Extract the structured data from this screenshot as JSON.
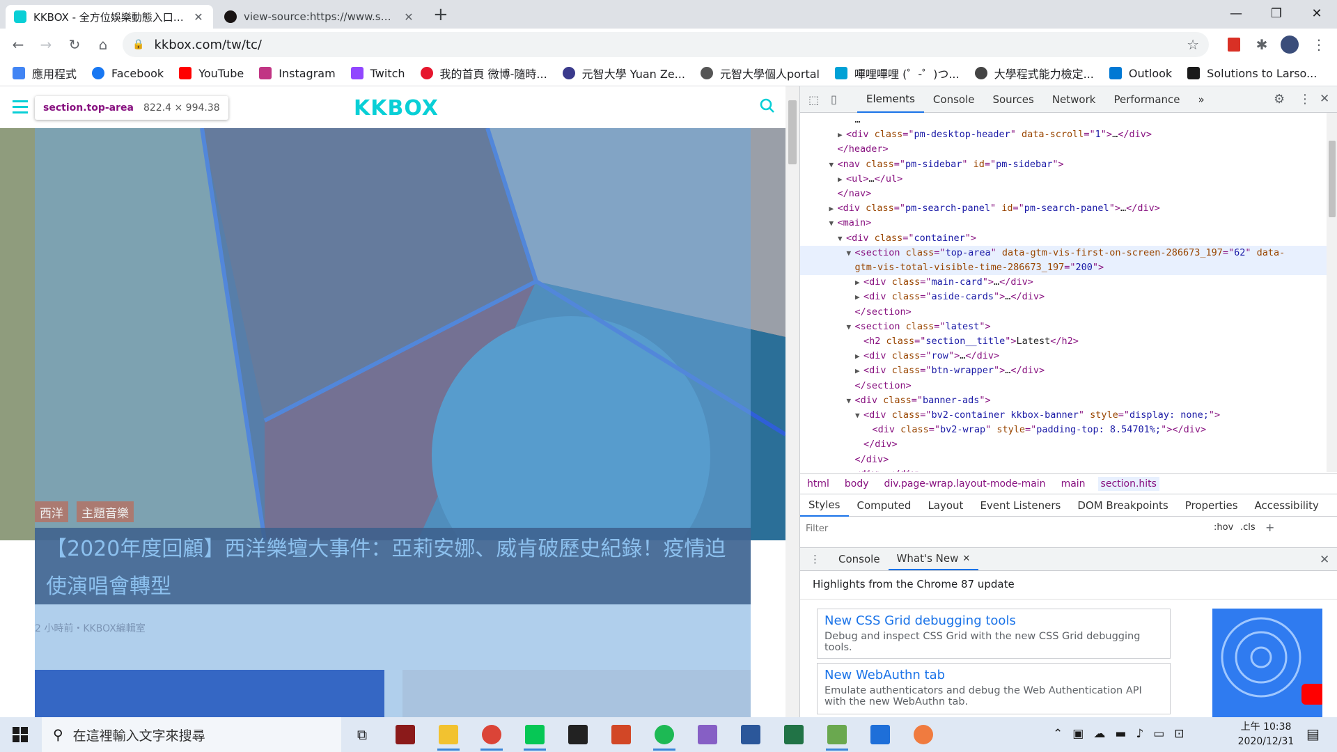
{
  "browser": {
    "tabs": [
      {
        "title": "KKBOX - 全方位娛樂動態入口網站",
        "active": true
      },
      {
        "title": "view-source:https://www.spotify",
        "active": false
      }
    ],
    "new_tab_label": "+",
    "url": "kkbox.com/tw/tc/",
    "bookmarks": [
      {
        "label": "應用程式",
        "color": "#4285f4"
      },
      {
        "label": "Facebook",
        "color": "#1877f2"
      },
      {
        "label": "YouTube",
        "color": "#ff0000"
      },
      {
        "label": "Instagram",
        "color": "#c13584"
      },
      {
        "label": "Twitch",
        "color": "#9146ff"
      },
      {
        "label": "我的首頁 微博-隨時...",
        "color": "#e6162d"
      },
      {
        "label": "元智大學 Yuan Ze...",
        "color": "#3a3a8c"
      },
      {
        "label": "元智大學個人portal",
        "color": "#555555"
      },
      {
        "label": "嗶哩嗶哩 (゜-゜)つ...",
        "color": "#00a1d6"
      },
      {
        "label": "大學程式能力檢定...",
        "color": "#444444"
      },
      {
        "label": "Outlook",
        "color": "#0078d4"
      },
      {
        "label": "Solutions to Larso...",
        "color": "#1a1a1a"
      }
    ]
  },
  "page": {
    "logo": "KKBOX",
    "tooltip_selector": "section.top-area",
    "tooltip_dims": "822.4 × 994.38",
    "chips": [
      "西洋",
      "主題音樂"
    ],
    "headline": "【2020年度回顧】西洋樂壇大事件：亞莉安娜、威肯破歷史紀錄！疫情迫使演唱會轉型",
    "meta": "2 小時前・KKBOX編輯室"
  },
  "devtools": {
    "tabs": [
      "Elements",
      "Console",
      "Sources",
      "Network",
      "Performance"
    ],
    "dom_lines": [
      {
        "indent": 5,
        "tri": "",
        "html": [
          [
            "tx",
            "…"
          ]
        ]
      },
      {
        "indent": 4,
        "tri": "▶",
        "html": [
          [
            "tg",
            "<div "
          ],
          [
            "an",
            "class"
          ],
          [
            "tg",
            "=\""
          ],
          [
            "av",
            "pm-desktop-header"
          ],
          [
            "tg",
            "\" "
          ],
          [
            "an",
            "data-scroll"
          ],
          [
            "tg",
            "=\""
          ],
          [
            "av",
            "1"
          ],
          [
            "tg",
            "\">"
          ],
          [
            "tx",
            "…"
          ],
          [
            "tg",
            "</div>"
          ]
        ]
      },
      {
        "indent": 3,
        "tri": "",
        "html": [
          [
            "tg",
            "</header>"
          ]
        ]
      },
      {
        "indent": 3,
        "tri": "▼",
        "html": [
          [
            "tg",
            "<nav "
          ],
          [
            "an",
            "class"
          ],
          [
            "tg",
            "=\""
          ],
          [
            "av",
            "pm-sidebar"
          ],
          [
            "tg",
            "\" "
          ],
          [
            "an",
            "id"
          ],
          [
            "tg",
            "=\""
          ],
          [
            "av",
            "pm-sidebar"
          ],
          [
            "tg",
            "\">"
          ]
        ]
      },
      {
        "indent": 4,
        "tri": "▶",
        "html": [
          [
            "tg",
            "<ul>"
          ],
          [
            "tx",
            "…"
          ],
          [
            "tg",
            "</ul>"
          ]
        ]
      },
      {
        "indent": 3,
        "tri": "",
        "html": [
          [
            "tg",
            "</nav>"
          ]
        ]
      },
      {
        "indent": 3,
        "tri": "▶",
        "html": [
          [
            "tg",
            "<div "
          ],
          [
            "an",
            "class"
          ],
          [
            "tg",
            "=\""
          ],
          [
            "av",
            "pm-search-panel"
          ],
          [
            "tg",
            "\" "
          ],
          [
            "an",
            "id"
          ],
          [
            "tg",
            "=\""
          ],
          [
            "av",
            "pm-search-panel"
          ],
          [
            "tg",
            "\">"
          ],
          [
            "tx",
            "…"
          ],
          [
            "tg",
            "</div>"
          ]
        ]
      },
      {
        "indent": 3,
        "tri": "▼",
        "html": [
          [
            "tg",
            "<main>"
          ]
        ]
      },
      {
        "indent": 4,
        "tri": "▼",
        "html": [
          [
            "tg",
            "<div "
          ],
          [
            "an",
            "class"
          ],
          [
            "tg",
            "=\""
          ],
          [
            "av",
            "container"
          ],
          [
            "tg",
            "\">"
          ]
        ]
      },
      {
        "indent": 5,
        "tri": "▼",
        "hl": true,
        "html": [
          [
            "tg",
            "<section "
          ],
          [
            "an",
            "class"
          ],
          [
            "tg",
            "=\""
          ],
          [
            "av",
            "top-area"
          ],
          [
            "tg",
            "\" "
          ],
          [
            "an",
            "data-gtm-vis-first-on-screen-286673_197"
          ],
          [
            "tg",
            "=\""
          ],
          [
            "av",
            "62"
          ],
          [
            "tg",
            "\" "
          ],
          [
            "an",
            "data-"
          ]
        ]
      },
      {
        "indent": 5,
        "tri": "",
        "hl": true,
        "html": [
          [
            "an",
            "gtm-vis-total-visible-time-286673_197"
          ],
          [
            "tg",
            "=\""
          ],
          [
            "av",
            "200"
          ],
          [
            "tg",
            "\">"
          ]
        ]
      },
      {
        "indent": 6,
        "tri": "▶",
        "html": [
          [
            "tg",
            "<div "
          ],
          [
            "an",
            "class"
          ],
          [
            "tg",
            "=\""
          ],
          [
            "av",
            "main-card"
          ],
          [
            "tg",
            "\">"
          ],
          [
            "tx",
            "…"
          ],
          [
            "tg",
            "</div>"
          ]
        ]
      },
      {
        "indent": 6,
        "tri": "▶",
        "html": [
          [
            "tg",
            "<div "
          ],
          [
            "an",
            "class"
          ],
          [
            "tg",
            "=\""
          ],
          [
            "av",
            "aside-cards"
          ],
          [
            "tg",
            "\">"
          ],
          [
            "tx",
            "…"
          ],
          [
            "tg",
            "</div>"
          ]
        ]
      },
      {
        "indent": 5,
        "tri": "",
        "html": [
          [
            "tg",
            "</section>"
          ]
        ]
      },
      {
        "indent": 5,
        "tri": "▼",
        "html": [
          [
            "tg",
            "<section "
          ],
          [
            "an",
            "class"
          ],
          [
            "tg",
            "=\""
          ],
          [
            "av",
            "latest"
          ],
          [
            "tg",
            "\">"
          ]
        ]
      },
      {
        "indent": 6,
        "tri": "",
        "html": [
          [
            "tg",
            "<h2 "
          ],
          [
            "an",
            "class"
          ],
          [
            "tg",
            "=\""
          ],
          [
            "av",
            "section__title"
          ],
          [
            "tg",
            "\">"
          ],
          [
            "tx",
            "Latest"
          ],
          [
            "tg",
            "</h2>"
          ]
        ]
      },
      {
        "indent": 6,
        "tri": "▶",
        "html": [
          [
            "tg",
            "<div "
          ],
          [
            "an",
            "class"
          ],
          [
            "tg",
            "=\""
          ],
          [
            "av",
            "row"
          ],
          [
            "tg",
            "\">"
          ],
          [
            "tx",
            "…"
          ],
          [
            "tg",
            "</div>"
          ]
        ]
      },
      {
        "indent": 6,
        "tri": "▶",
        "html": [
          [
            "tg",
            "<div "
          ],
          [
            "an",
            "class"
          ],
          [
            "tg",
            "=\""
          ],
          [
            "av",
            "btn-wrapper"
          ],
          [
            "tg",
            "\">"
          ],
          [
            "tx",
            "…"
          ],
          [
            "tg",
            "</div>"
          ]
        ]
      },
      {
        "indent": 5,
        "tri": "",
        "html": [
          [
            "tg",
            "</section>"
          ]
        ]
      },
      {
        "indent": 5,
        "tri": "▼",
        "html": [
          [
            "tg",
            "<div "
          ],
          [
            "an",
            "class"
          ],
          [
            "tg",
            "=\""
          ],
          [
            "av",
            "banner-ads"
          ],
          [
            "tg",
            "\">"
          ]
        ]
      },
      {
        "indent": 6,
        "tri": "▼",
        "html": [
          [
            "tg",
            "<div "
          ],
          [
            "an",
            "class"
          ],
          [
            "tg",
            "=\""
          ],
          [
            "av",
            "bv2-container kkbox-banner"
          ],
          [
            "tg",
            "\" "
          ],
          [
            "an",
            "style"
          ],
          [
            "tg",
            "=\""
          ],
          [
            "av",
            "display: none;"
          ],
          [
            "tg",
            "\">"
          ]
        ]
      },
      {
        "indent": 7,
        "tri": "",
        "html": [
          [
            "tg",
            "<div "
          ],
          [
            "an",
            "class"
          ],
          [
            "tg",
            "=\""
          ],
          [
            "av",
            "bv2-wrap"
          ],
          [
            "tg",
            "\" "
          ],
          [
            "an",
            "style"
          ],
          [
            "tg",
            "=\""
          ],
          [
            "av",
            "padding-top: 8.54701%;"
          ],
          [
            "tg",
            "\"></div>"
          ]
        ]
      },
      {
        "indent": 6,
        "tri": "",
        "html": [
          [
            "tg",
            "</div>"
          ]
        ]
      },
      {
        "indent": 5,
        "tri": "",
        "html": [
          [
            "tg",
            "</div>"
          ]
        ]
      },
      {
        "indent": 5,
        "tri": "▶",
        "html": [
          [
            "tg",
            "<div>"
          ],
          [
            "tx",
            "…"
          ],
          [
            "tg",
            "</div>"
          ]
        ]
      }
    ],
    "breadcrumbs": [
      "html",
      "body",
      "div.page-wrap.layout-mode-main",
      "main",
      "section.hits"
    ],
    "subtabs": [
      "Styles",
      "Computed",
      "Layout",
      "Event Listeners",
      "DOM Breakpoints",
      "Properties",
      "Accessibility"
    ],
    "filter_placeholder": "Filter",
    "hov_label": ":hov",
    "cls_label": ".cls",
    "drawer_tabs": [
      "Console",
      "What's New"
    ],
    "whats_new_heading": "Highlights from the Chrome 87 update",
    "cards": [
      {
        "title": "New CSS Grid debugging tools",
        "desc": "Debug and inspect CSS Grid with the new CSS Grid debugging tools."
      },
      {
        "title": "New WebAuthn tab",
        "desc": "Emulate authenticators and debug the Web Authentication API with the new WebAuthn tab."
      }
    ]
  },
  "taskbar": {
    "search_placeholder": "在這裡輸入文字來搜尋",
    "time": "上午 10:38",
    "date": "2020/12/31"
  }
}
